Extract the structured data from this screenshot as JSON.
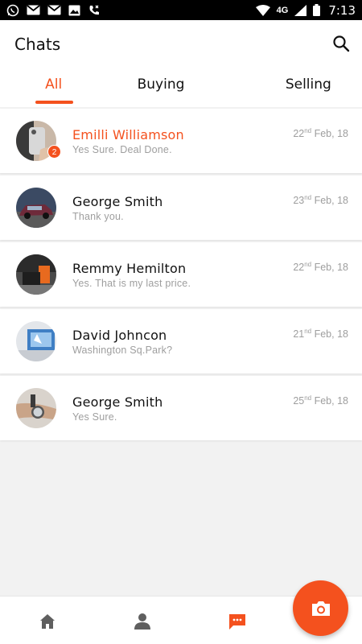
{
  "status_bar": {
    "time": "7:13",
    "network": "4G",
    "notification_icons": [
      "whatsapp-icon",
      "gmail-icon",
      "gmail-icon",
      "gallery-icon",
      "missed-call-icon"
    ]
  },
  "header": {
    "title": "Chats",
    "tabs": [
      {
        "label": "All",
        "active": true
      },
      {
        "label": "Buying",
        "active": false
      },
      {
        "label": "Selling",
        "active": false
      }
    ]
  },
  "chats": [
    {
      "name": "Emilli Williamson",
      "message": "Yes Sure. Deal Done.",
      "day": "22",
      "suffix": "nd",
      "month_year": " Feb, 18",
      "unread": "2"
    },
    {
      "name": "George Smith",
      "message": "Thank you.",
      "day": "23",
      "suffix": "nd",
      "month_year": " Feb, 18"
    },
    {
      "name": "Remmy Hemilton",
      "message": "Yes. That is my last price.",
      "day": "22",
      "suffix": "nd",
      "month_year": " Feb, 18"
    },
    {
      "name": "David Johncon",
      "message": "Washington Sq.Park?",
      "day": "21",
      "suffix": "nd",
      "month_year": " Feb, 18"
    },
    {
      "name": "George Smith",
      "message": "Yes Sure.",
      "day": "25",
      "suffix": "nd",
      "month_year": " Feb, 18"
    }
  ],
  "bottom_nav": [
    "home-icon",
    "profile-icon",
    "chat-icon"
  ],
  "fab_icon": "camera-icon",
  "colors": {
    "accent": "#f4511e",
    "background": "#f2f2f2",
    "muted_text": "#9e9e9e"
  }
}
